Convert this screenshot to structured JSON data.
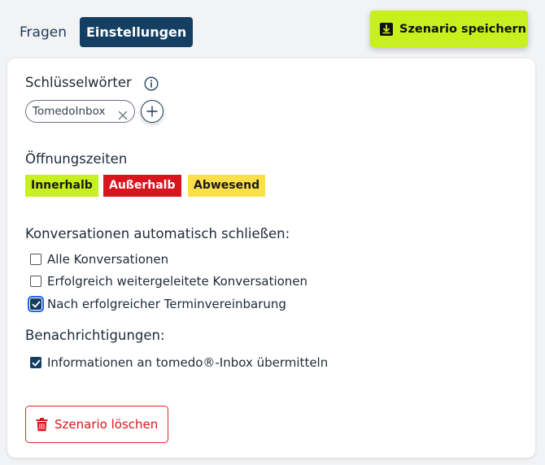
{
  "tabs": {
    "fragen": "Fragen",
    "einstellungen": "Einstellungen"
  },
  "header": {
    "save_label": "Szenario speichern"
  },
  "keywords": {
    "title": "Schlüsselwörter",
    "chips": [
      "TomedoInbox"
    ]
  },
  "opening_hours": {
    "title": "Öffnungszeiten",
    "badges": {
      "inside": "Innerhalb",
      "outside": "Außerhalb",
      "absent": "Abwesend"
    }
  },
  "auto_close": {
    "title": "Konversationen automatisch schließen:",
    "options": [
      {
        "label": "Alle Konversationen",
        "checked": false
      },
      {
        "label": "Erfolgreich weitergeleitete Konversationen",
        "checked": false
      },
      {
        "label": "Nach erfolgreicher Terminvereinbarung",
        "checked": true
      }
    ]
  },
  "notifications": {
    "title": "Benachrichtigungen:",
    "options": [
      {
        "label": "Informationen an tomedo®-Inbox übermitteln",
        "checked": true
      }
    ]
  },
  "delete_label": "Szenario löschen",
  "colors": {
    "accent_green": "#c8ef1e",
    "navy": "#143f63",
    "danger_red": "#d9141c",
    "warning_yellow": "#fadf4a"
  },
  "icons": {
    "save": "download-icon",
    "info": "info-icon",
    "chip_remove": "close-icon",
    "add": "plus-icon",
    "delete": "trash-icon"
  }
}
